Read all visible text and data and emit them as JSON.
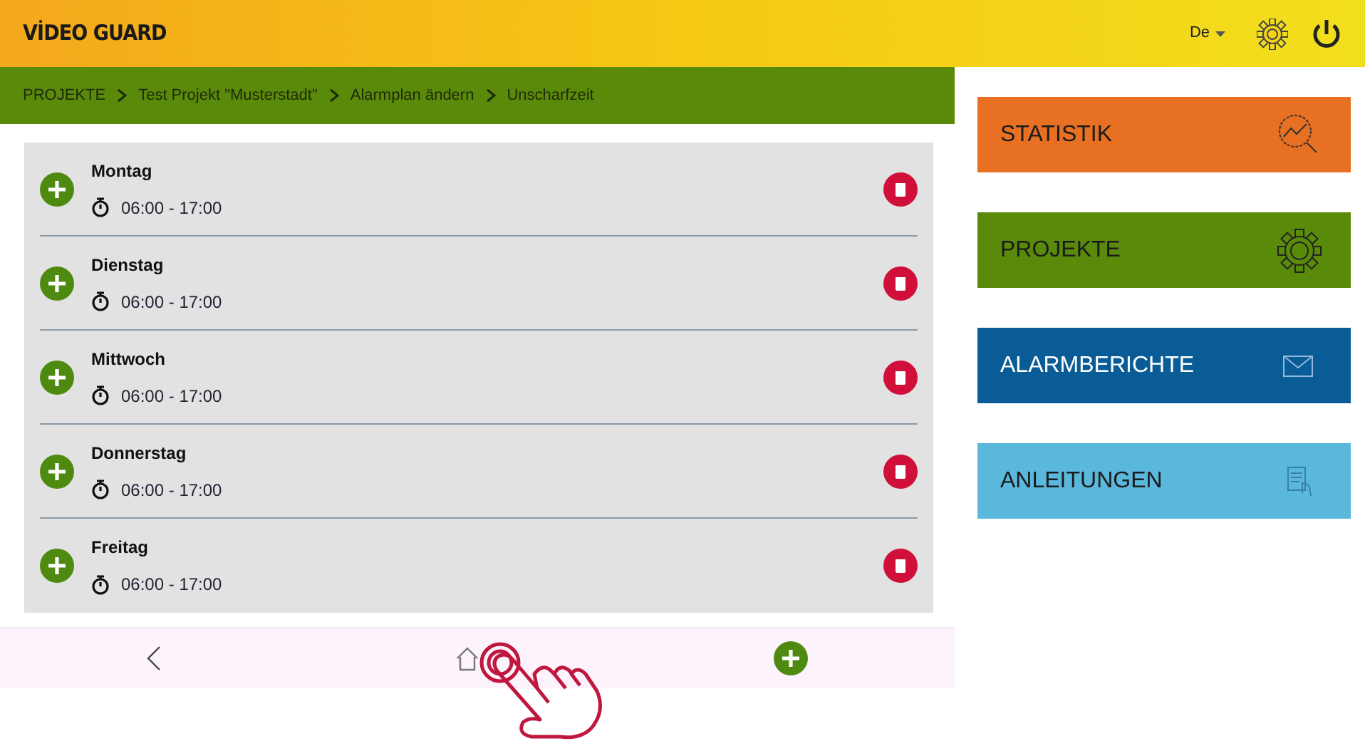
{
  "header": {
    "logo": "VİDEO GUARD",
    "language": "De"
  },
  "breadcrumb": [
    {
      "label": "PROJEKTE"
    },
    {
      "label": "Test Projekt \"Musterstadt\""
    },
    {
      "label": "Alarmplan ändern"
    },
    {
      "label": "Unscharfzeit"
    }
  ],
  "days": [
    {
      "name": "Montag",
      "time": "06:00 - 17:00"
    },
    {
      "name": "Dienstag",
      "time": "06:00 - 17:00"
    },
    {
      "name": "Mittwoch",
      "time": "06:00 - 17:00"
    },
    {
      "name": "Donnerstag",
      "time": "06:00 - 17:00"
    },
    {
      "name": "Freitag",
      "time": "06:00 - 17:00"
    }
  ],
  "menu": [
    {
      "label": "STATISTIK",
      "kind": "statistics",
      "color": "#e87022"
    },
    {
      "label": "PROJEKTE",
      "kind": "projects",
      "color": "#5a8a0a"
    },
    {
      "label": "ALARMBERICHTE",
      "kind": "reports",
      "color": "#0a5c96"
    },
    {
      "label": "ANLEITUNGEN",
      "kind": "guides",
      "color": "#5ab8dd"
    }
  ]
}
